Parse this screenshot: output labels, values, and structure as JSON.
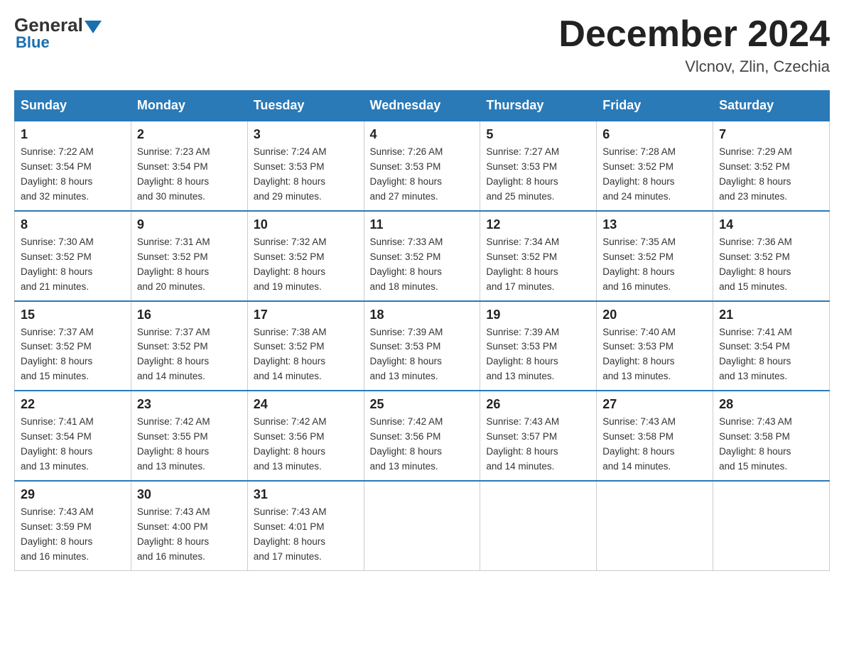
{
  "header": {
    "logo_general": "General",
    "logo_blue": "Blue",
    "month_title": "December 2024",
    "location": "Vlcnov, Zlin, Czechia"
  },
  "days_of_week": [
    "Sunday",
    "Monday",
    "Tuesday",
    "Wednesday",
    "Thursday",
    "Friday",
    "Saturday"
  ],
  "weeks": [
    [
      {
        "num": "1",
        "info": "Sunrise: 7:22 AM\nSunset: 3:54 PM\nDaylight: 8 hours\nand 32 minutes."
      },
      {
        "num": "2",
        "info": "Sunrise: 7:23 AM\nSunset: 3:54 PM\nDaylight: 8 hours\nand 30 minutes."
      },
      {
        "num": "3",
        "info": "Sunrise: 7:24 AM\nSunset: 3:53 PM\nDaylight: 8 hours\nand 29 minutes."
      },
      {
        "num": "4",
        "info": "Sunrise: 7:26 AM\nSunset: 3:53 PM\nDaylight: 8 hours\nand 27 minutes."
      },
      {
        "num": "5",
        "info": "Sunrise: 7:27 AM\nSunset: 3:53 PM\nDaylight: 8 hours\nand 25 minutes."
      },
      {
        "num": "6",
        "info": "Sunrise: 7:28 AM\nSunset: 3:52 PM\nDaylight: 8 hours\nand 24 minutes."
      },
      {
        "num": "7",
        "info": "Sunrise: 7:29 AM\nSunset: 3:52 PM\nDaylight: 8 hours\nand 23 minutes."
      }
    ],
    [
      {
        "num": "8",
        "info": "Sunrise: 7:30 AM\nSunset: 3:52 PM\nDaylight: 8 hours\nand 21 minutes."
      },
      {
        "num": "9",
        "info": "Sunrise: 7:31 AM\nSunset: 3:52 PM\nDaylight: 8 hours\nand 20 minutes."
      },
      {
        "num": "10",
        "info": "Sunrise: 7:32 AM\nSunset: 3:52 PM\nDaylight: 8 hours\nand 19 minutes."
      },
      {
        "num": "11",
        "info": "Sunrise: 7:33 AM\nSunset: 3:52 PM\nDaylight: 8 hours\nand 18 minutes."
      },
      {
        "num": "12",
        "info": "Sunrise: 7:34 AM\nSunset: 3:52 PM\nDaylight: 8 hours\nand 17 minutes."
      },
      {
        "num": "13",
        "info": "Sunrise: 7:35 AM\nSunset: 3:52 PM\nDaylight: 8 hours\nand 16 minutes."
      },
      {
        "num": "14",
        "info": "Sunrise: 7:36 AM\nSunset: 3:52 PM\nDaylight: 8 hours\nand 15 minutes."
      }
    ],
    [
      {
        "num": "15",
        "info": "Sunrise: 7:37 AM\nSunset: 3:52 PM\nDaylight: 8 hours\nand 15 minutes."
      },
      {
        "num": "16",
        "info": "Sunrise: 7:37 AM\nSunset: 3:52 PM\nDaylight: 8 hours\nand 14 minutes."
      },
      {
        "num": "17",
        "info": "Sunrise: 7:38 AM\nSunset: 3:52 PM\nDaylight: 8 hours\nand 14 minutes."
      },
      {
        "num": "18",
        "info": "Sunrise: 7:39 AM\nSunset: 3:53 PM\nDaylight: 8 hours\nand 13 minutes."
      },
      {
        "num": "19",
        "info": "Sunrise: 7:39 AM\nSunset: 3:53 PM\nDaylight: 8 hours\nand 13 minutes."
      },
      {
        "num": "20",
        "info": "Sunrise: 7:40 AM\nSunset: 3:53 PM\nDaylight: 8 hours\nand 13 minutes."
      },
      {
        "num": "21",
        "info": "Sunrise: 7:41 AM\nSunset: 3:54 PM\nDaylight: 8 hours\nand 13 minutes."
      }
    ],
    [
      {
        "num": "22",
        "info": "Sunrise: 7:41 AM\nSunset: 3:54 PM\nDaylight: 8 hours\nand 13 minutes."
      },
      {
        "num": "23",
        "info": "Sunrise: 7:42 AM\nSunset: 3:55 PM\nDaylight: 8 hours\nand 13 minutes."
      },
      {
        "num": "24",
        "info": "Sunrise: 7:42 AM\nSunset: 3:56 PM\nDaylight: 8 hours\nand 13 minutes."
      },
      {
        "num": "25",
        "info": "Sunrise: 7:42 AM\nSunset: 3:56 PM\nDaylight: 8 hours\nand 13 minutes."
      },
      {
        "num": "26",
        "info": "Sunrise: 7:43 AM\nSunset: 3:57 PM\nDaylight: 8 hours\nand 14 minutes."
      },
      {
        "num": "27",
        "info": "Sunrise: 7:43 AM\nSunset: 3:58 PM\nDaylight: 8 hours\nand 14 minutes."
      },
      {
        "num": "28",
        "info": "Sunrise: 7:43 AM\nSunset: 3:58 PM\nDaylight: 8 hours\nand 15 minutes."
      }
    ],
    [
      {
        "num": "29",
        "info": "Sunrise: 7:43 AM\nSunset: 3:59 PM\nDaylight: 8 hours\nand 16 minutes."
      },
      {
        "num": "30",
        "info": "Sunrise: 7:43 AM\nSunset: 4:00 PM\nDaylight: 8 hours\nand 16 minutes."
      },
      {
        "num": "31",
        "info": "Sunrise: 7:43 AM\nSunset: 4:01 PM\nDaylight: 8 hours\nand 17 minutes."
      },
      null,
      null,
      null,
      null
    ]
  ]
}
